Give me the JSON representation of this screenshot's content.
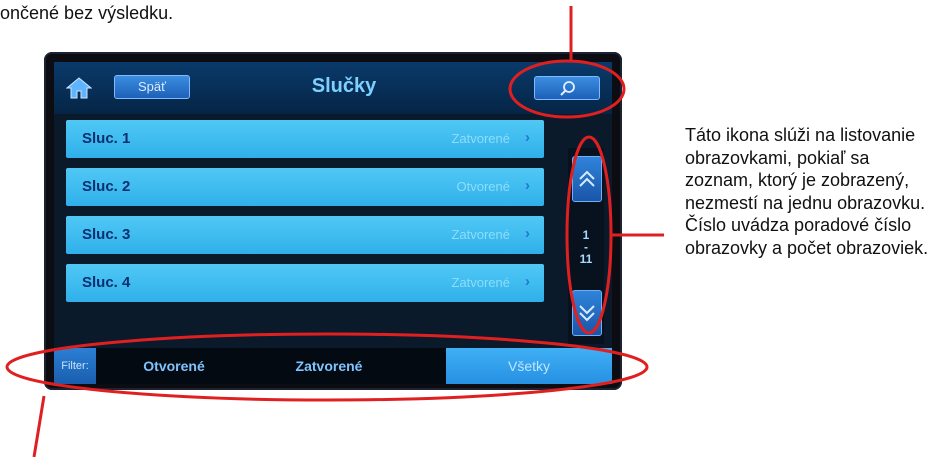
{
  "annotations": {
    "top_text": "ončené bez výsledku.",
    "side_text": "Táto ikona slúži na listovanie obrazovkami, pokiaľ sa zoznam, ktorý je zobrazený, nezmestí na jednu obrazovku. Číslo uvádza poradové číslo obrazovky a počet obrazoviek.",
    "highlight_color": "#e02020"
  },
  "header": {
    "home_icon": "home-icon",
    "back_label": "Späť",
    "title": "Slučky",
    "search_icon": "search-icon"
  },
  "list": {
    "items": [
      {
        "name": "Sluc. 1",
        "status": "Zatvorené"
      },
      {
        "name": "Sluc. 2",
        "status": "Otvorené"
      },
      {
        "name": "Sluc. 3",
        "status": "Zatvorené"
      },
      {
        "name": "Sluc. 4",
        "status": "Zatvorené"
      }
    ],
    "chevron": "›"
  },
  "pager": {
    "current": "1",
    "separator": "-",
    "total": "11",
    "up_icon": "double-chevron-up-icon",
    "down_icon": "double-chevron-down-icon"
  },
  "filter": {
    "label": "Filter:",
    "options": [
      "Otvorené",
      "Zatvorené",
      "Všetky"
    ],
    "active": "Všetky"
  },
  "colors": {
    "header_bg": "#0a3a6a",
    "row_bg": "#2fb0ea",
    "title": "#7ed0ff"
  }
}
